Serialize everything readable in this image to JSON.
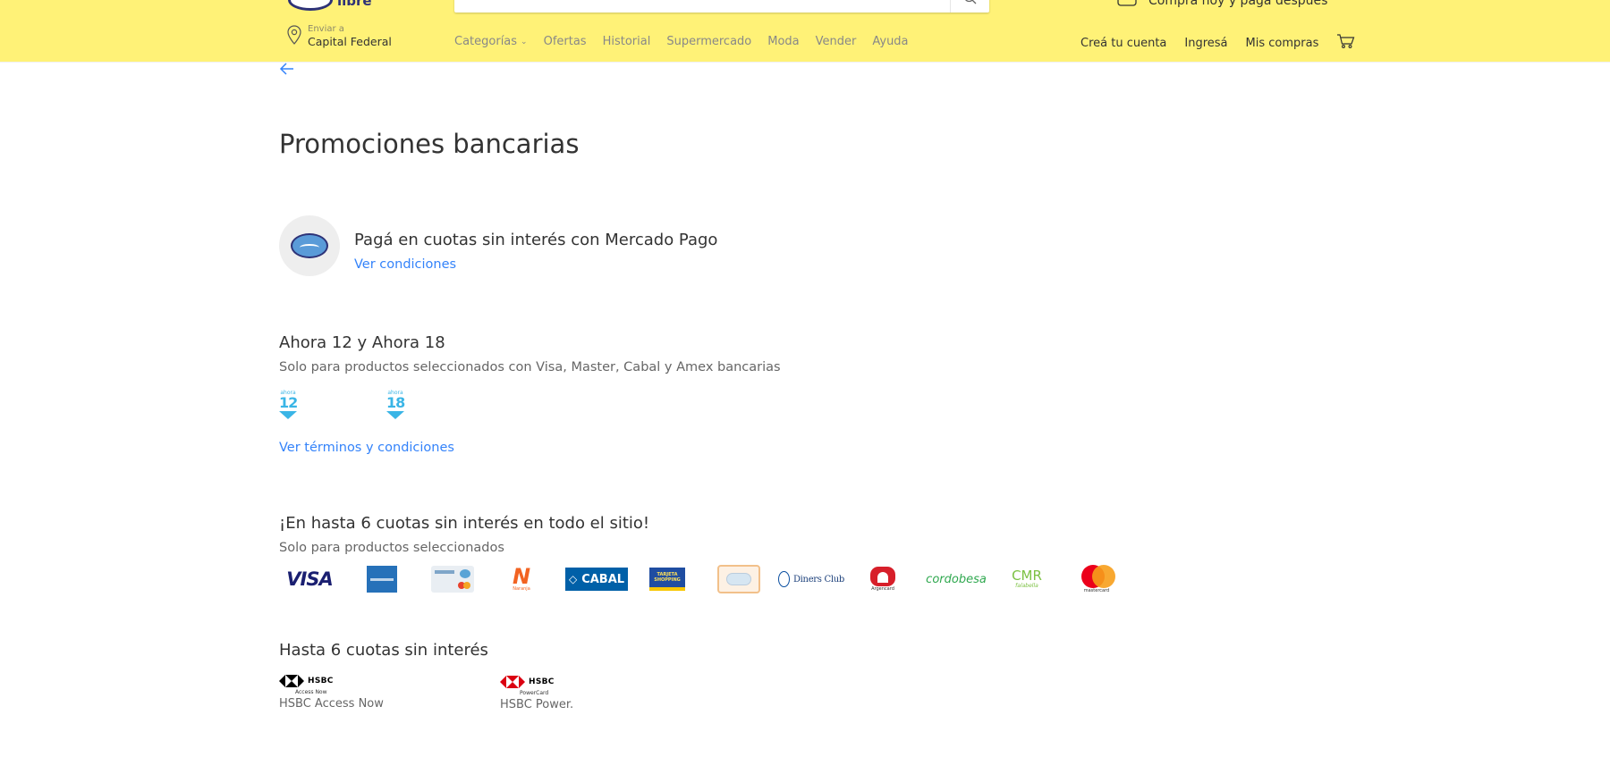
{
  "header": {
    "logo_text": "libre",
    "promo_text": "Comprá hoy y pagá después",
    "location": {
      "label": "Enviar a",
      "value": "Capital Federal"
    },
    "nav": [
      "Categorías",
      "Ofertas",
      "Historial",
      "Supermercado",
      "Moda",
      "Vender",
      "Ayuda"
    ],
    "user_nav": [
      "Creá tu cuenta",
      "Ingresá",
      "Mis compras"
    ]
  },
  "page": {
    "title": "Promociones bancarias"
  },
  "mercado_pago": {
    "title": "Pagá en cuotas sin interés con Mercado Pago",
    "link": "Ver condiciones"
  },
  "ahora": {
    "title": "Ahora 12 y Ahora 18",
    "subtitle": "Solo para productos seleccionados con Visa, Master, Cabal y Amex bancarias",
    "badges": [
      {
        "small": "ahora",
        "num": "12"
      },
      {
        "small": "ahora",
        "num": "18"
      }
    ],
    "link": "Ver términos y condiciones"
  },
  "six_cuotas": {
    "title": "¡En hasta 6 cuotas sin interés en todo el sitio!",
    "subtitle": "Solo para productos seleccionados",
    "cards": [
      "VISA",
      "CABAL",
      "Diners Club",
      "cordobesa",
      "CMR",
      "mastercard"
    ],
    "card_small_labels": [
      "TARJETA SHOPPING",
      "Argencard",
      "falabella",
      "Naranja"
    ]
  },
  "hsbc": {
    "title": "Hasta 6 cuotas sin interés",
    "items": [
      {
        "word": "HSBC",
        "sub": "Access Now",
        "name": "HSBC Access Now"
      },
      {
        "word": "HSBC",
        "sub": "PowerCard",
        "name": "HSBC Power."
      }
    ]
  },
  "colors": {
    "header_bg": "#fff277",
    "link": "#3483fa",
    "ahora": "#3ab5e6"
  }
}
